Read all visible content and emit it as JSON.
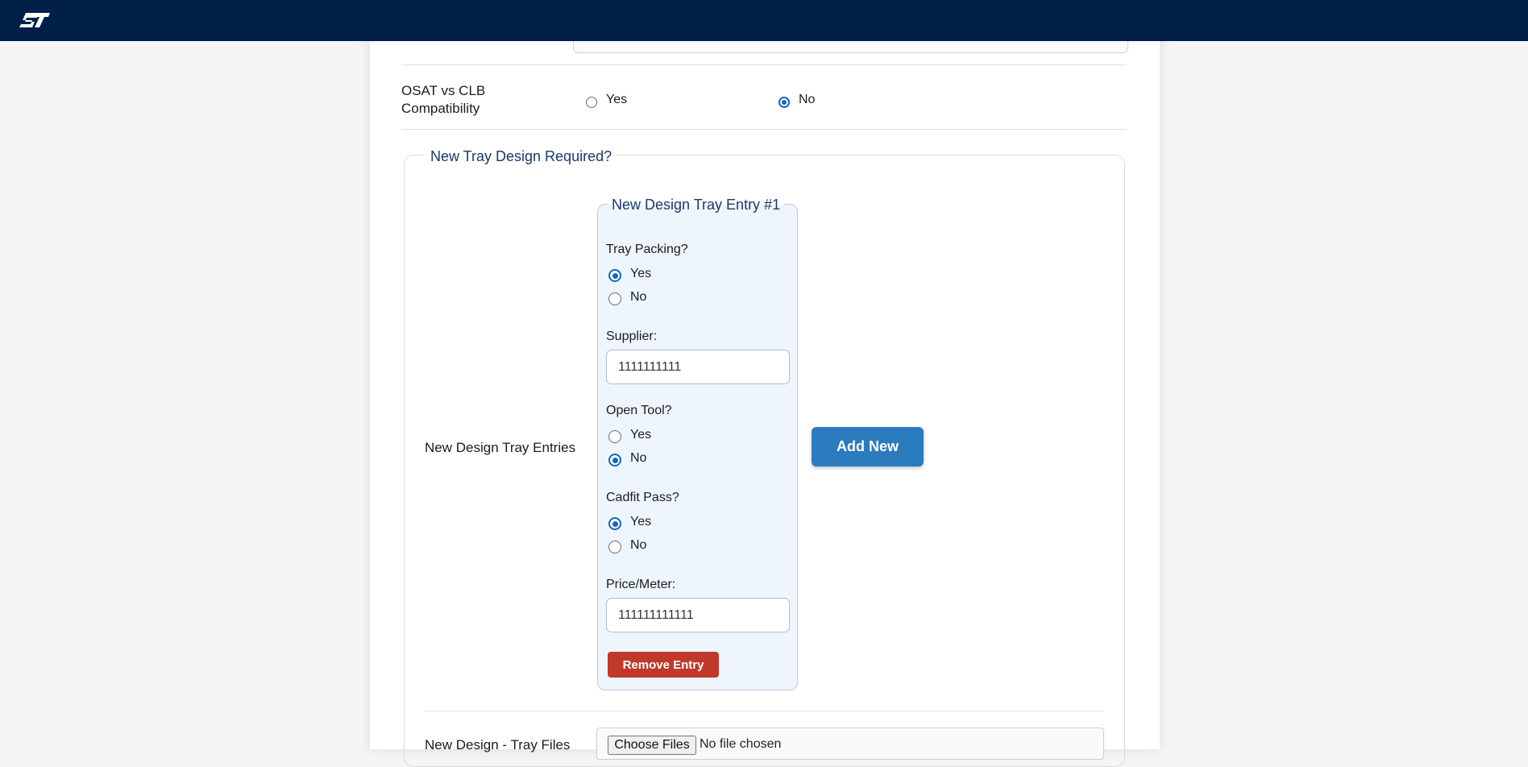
{
  "topbar": {
    "logo_text": "ST",
    "brand_color": "#00204a"
  },
  "osat": {
    "label": "OSAT vs CLB Compatibility",
    "options": [
      {
        "label": "Yes",
        "checked": false
      },
      {
        "label": "No",
        "checked": true
      }
    ]
  },
  "tray_section": {
    "legend": "New Tray Design Required?",
    "entries_label": "New Design Tray Entries",
    "add_button": "Add New",
    "entry": {
      "title": "New Design Tray Entry #1",
      "tray_packing": {
        "label": "Tray Packing?",
        "yes": "Yes",
        "no": "No",
        "selected": "Yes"
      },
      "supplier": {
        "label": "Supplier:",
        "value": "1111111111"
      },
      "open_tool": {
        "label": "Open Tool?",
        "yes": "Yes",
        "no": "No",
        "selected": "No"
      },
      "cadfit_pass": {
        "label": "Cadfit Pass?",
        "yes": "Yes",
        "no": "No",
        "selected": "Yes"
      },
      "price_meter": {
        "label": "Price/Meter:",
        "value": "111111111111"
      },
      "remove_button": "Remove Entry"
    }
  },
  "tray_files": {
    "label": "New Design - Tray Files",
    "choose_button": "Choose Files",
    "status": "No file chosen"
  },
  "colors": {
    "accent": "#2b7bbf",
    "danger": "#c0392b",
    "radio_checked": "#1565c0",
    "legend_text": "#1a3a6b",
    "entry_bg": "#eef5fd"
  }
}
